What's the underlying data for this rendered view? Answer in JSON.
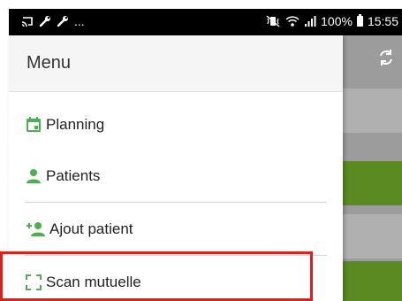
{
  "status_bar": {
    "left_icons": [
      "cast-icon",
      "wrench-icon",
      "wrench-icon"
    ],
    "left_more": "...",
    "battery_percent": "100%",
    "time": "15:55"
  },
  "drawer": {
    "title": "Menu",
    "items": [
      {
        "label": "Planning",
        "icon": "calendar-icon"
      },
      {
        "label": "Patients",
        "icon": "person-icon"
      },
      {
        "label": "Ajout patient",
        "icon": "add-person-icon"
      },
      {
        "label": "Scan mutuelle",
        "icon": "scan-icon"
      }
    ]
  },
  "colors": {
    "accent_green": "#4caf50",
    "highlight_red": "#e01e1e",
    "bg_green": "#5b8a22",
    "bg_gray": "#9c9c9c"
  }
}
